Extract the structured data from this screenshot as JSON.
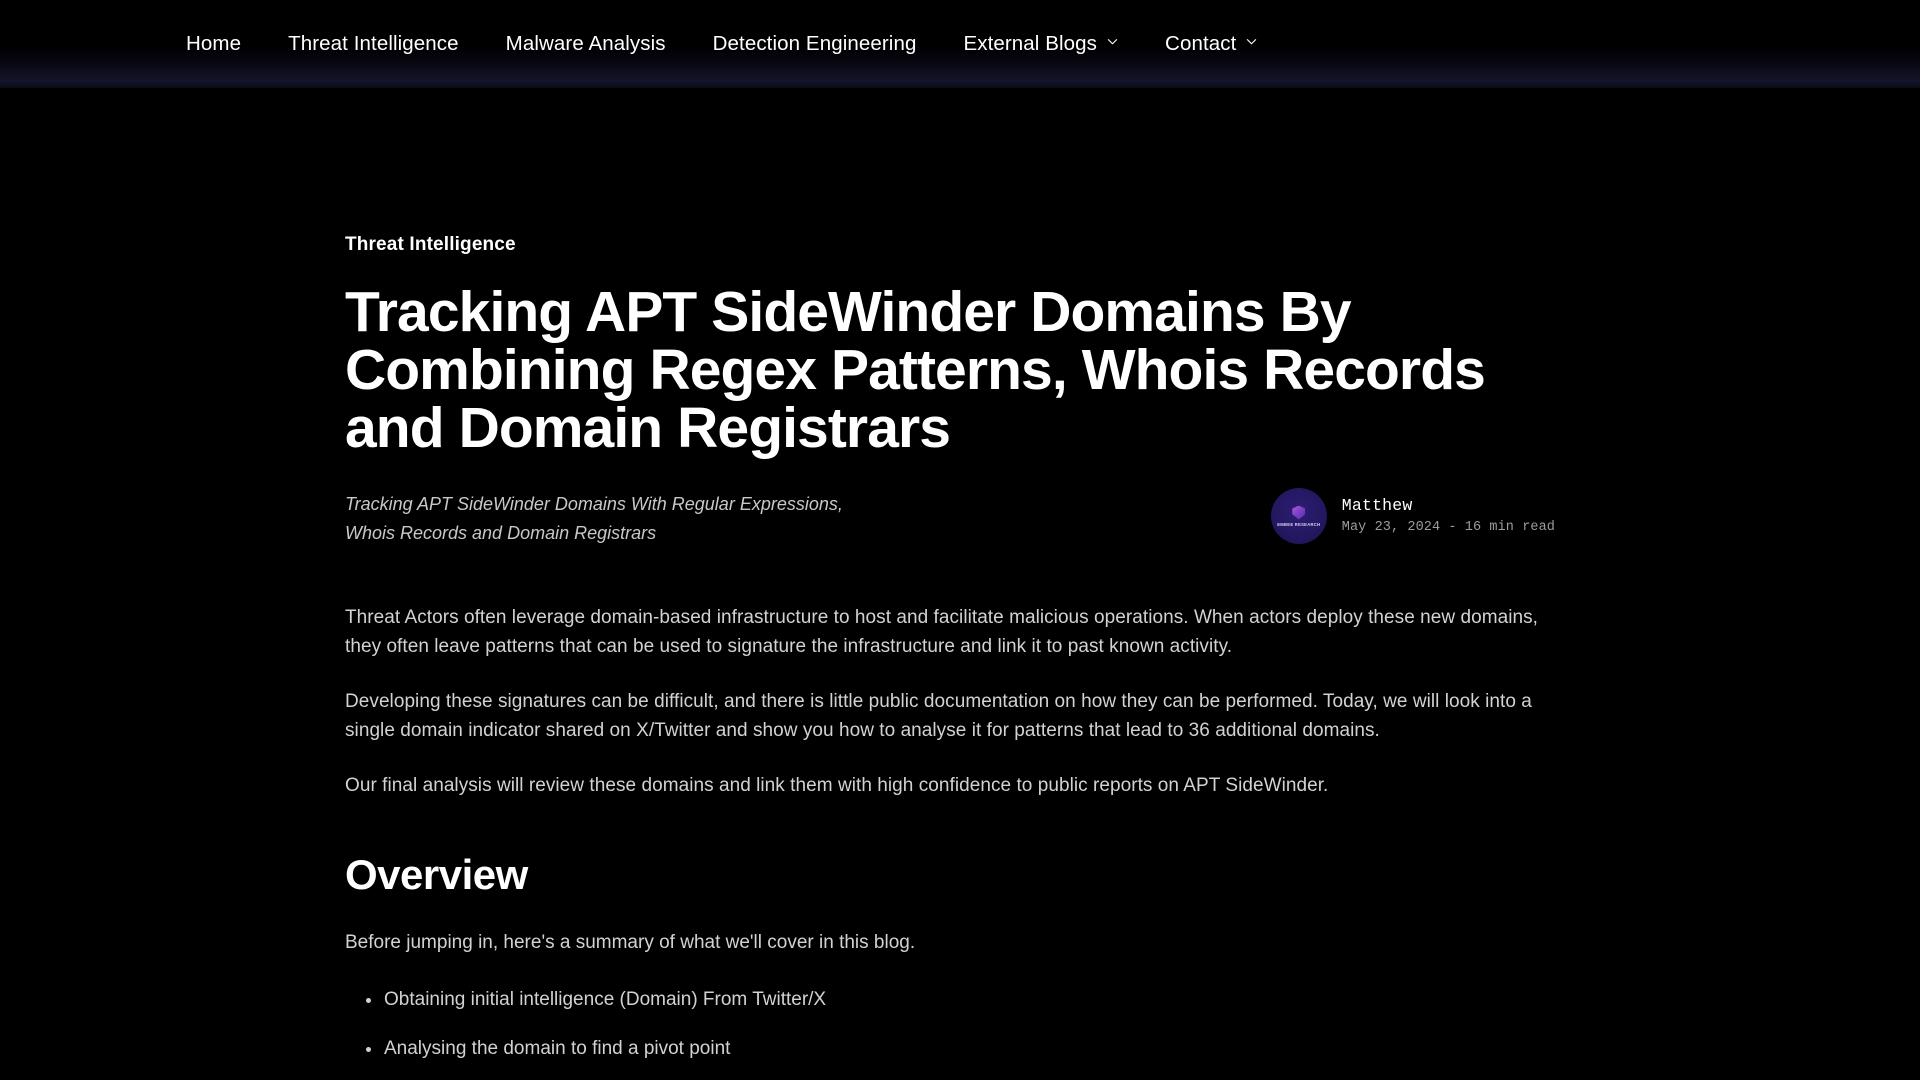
{
  "nav": {
    "items": [
      {
        "label": "Home",
        "has_dropdown": false,
        "icon": null
      },
      {
        "label": "Threat Intelligence",
        "has_dropdown": false,
        "icon": null
      },
      {
        "label": "Malware Analysis",
        "has_dropdown": false,
        "icon": null
      },
      {
        "label": "Detection Engineering",
        "has_dropdown": false,
        "icon": null
      },
      {
        "label": "External Blogs",
        "has_dropdown": true,
        "icon": "chevron-down-icon"
      },
      {
        "label": "Contact",
        "has_dropdown": true,
        "icon": "chevron-down-icon"
      }
    ]
  },
  "article": {
    "category": "Threat Intelligence",
    "title": "Tracking APT SideWinder Domains By Combining Regex Patterns, Whois Records and Domain Registrars",
    "subtitle": "Tracking APT SideWinder Domains With Regular Expressions, Whois Records and Domain Registrars",
    "author": {
      "name": "Matthew",
      "meta": "May 23, 2024 - 16 min read",
      "avatar_logo_text": "EMBEE RESEARCH"
    },
    "paragraphs": [
      "Threat Actors often leverage domain-based infrastructure to host and facilitate malicious operations. When actors deploy these new domains, they often leave patterns that can be used to signature the infrastructure and link it to past known activity.",
      "Developing these signatures can be difficult, and there is little public documentation on how they can be performed. Today, we will look into a single domain indicator shared on X/Twitter and show you how to analyse it for patterns that lead to 36 additional domains.",
      "Our final analysis will review these domains and link them with high confidence to public reports on APT SideWinder."
    ],
    "overview": {
      "heading": "Overview",
      "lead": "Before jumping in, here's a summary of what we'll cover in this blog.",
      "bullets": [
        "Obtaining initial intelligence (Domain) From Twitter/X",
        "Analysing the domain to find a pivot point"
      ]
    }
  },
  "colors": {
    "background": "#000000",
    "text_primary": "#ffffff",
    "text_body": "#d2d2d2",
    "text_muted": "#9c9c9c",
    "avatar_purple": "#241862",
    "header_gradient_navy": "#15152b"
  }
}
